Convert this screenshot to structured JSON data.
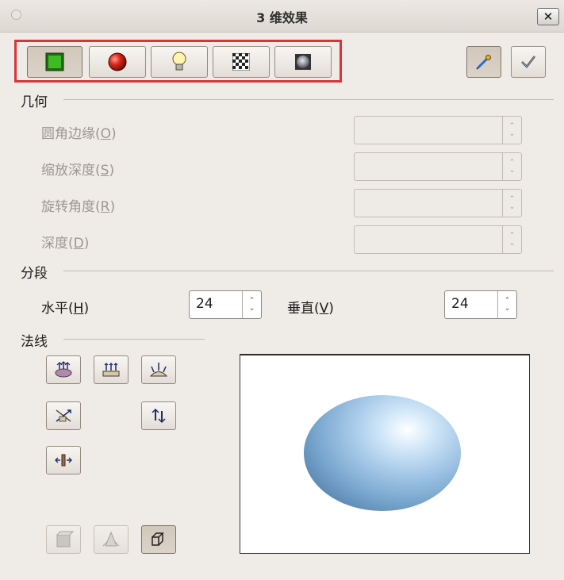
{
  "window": {
    "title": "3 维效果",
    "close_icon": "close-icon"
  },
  "toolbar": {
    "tabs": [
      {
        "id": "geometry",
        "icon": "geometry-cube-icon",
        "pressed": true
      },
      {
        "id": "shading",
        "icon": "shading-sphere-icon",
        "pressed": false
      },
      {
        "id": "illumination",
        "icon": "light-bulb-icon",
        "pressed": false
      },
      {
        "id": "textures",
        "icon": "checker-texture-icon",
        "pressed": false
      },
      {
        "id": "material",
        "icon": "material-icon",
        "pressed": false
      }
    ],
    "assign": {
      "icon": "eyedropper-icon",
      "pressed": true
    },
    "apply": {
      "icon": "checkmark-icon",
      "pressed": false
    }
  },
  "geometry": {
    "heading": "几何",
    "rounded_edges": {
      "label": "圆角边缘(",
      "key": "O",
      "label_end": ")",
      "value": "",
      "enabled": false
    },
    "scaled_depth": {
      "label": "缩放深度(",
      "key": "S",
      "label_end": ")",
      "value": "",
      "enabled": false
    },
    "rotation_angle": {
      "label": "旋转角度(",
      "key": "R",
      "label_end": ")",
      "value": "",
      "enabled": false
    },
    "depth": {
      "label": "深度(",
      "key": "D",
      "label_end": ")",
      "value": "",
      "enabled": false
    }
  },
  "segments": {
    "heading": "分段",
    "horizontal": {
      "label": "水平(",
      "key": "H",
      "label_end": ")",
      "value": "24"
    },
    "vertical": {
      "label": "垂直(",
      "key": "V",
      "label_end": ")",
      "value": "24"
    }
  },
  "normals": {
    "heading": "法线",
    "buttons": [
      {
        "icon": "object-specific-normals-icon"
      },
      {
        "icon": "flat-normals-icon"
      },
      {
        "icon": "spherical-normals-icon"
      },
      {
        "icon": "invert-normals-icon"
      },
      {
        "icon": "double-sided-illumination-icon"
      },
      {
        "icon": "double-sided-icon"
      }
    ],
    "bottom_buttons": [
      {
        "icon": "convert-to-3d-icon",
        "enabled": false
      },
      {
        "icon": "convert-to-lathe-icon",
        "enabled": false
      },
      {
        "icon": "perspective-toggle-icon",
        "enabled": true
      }
    ]
  },
  "preview": {
    "shape": "sphere",
    "color": "#7aa7cf"
  }
}
